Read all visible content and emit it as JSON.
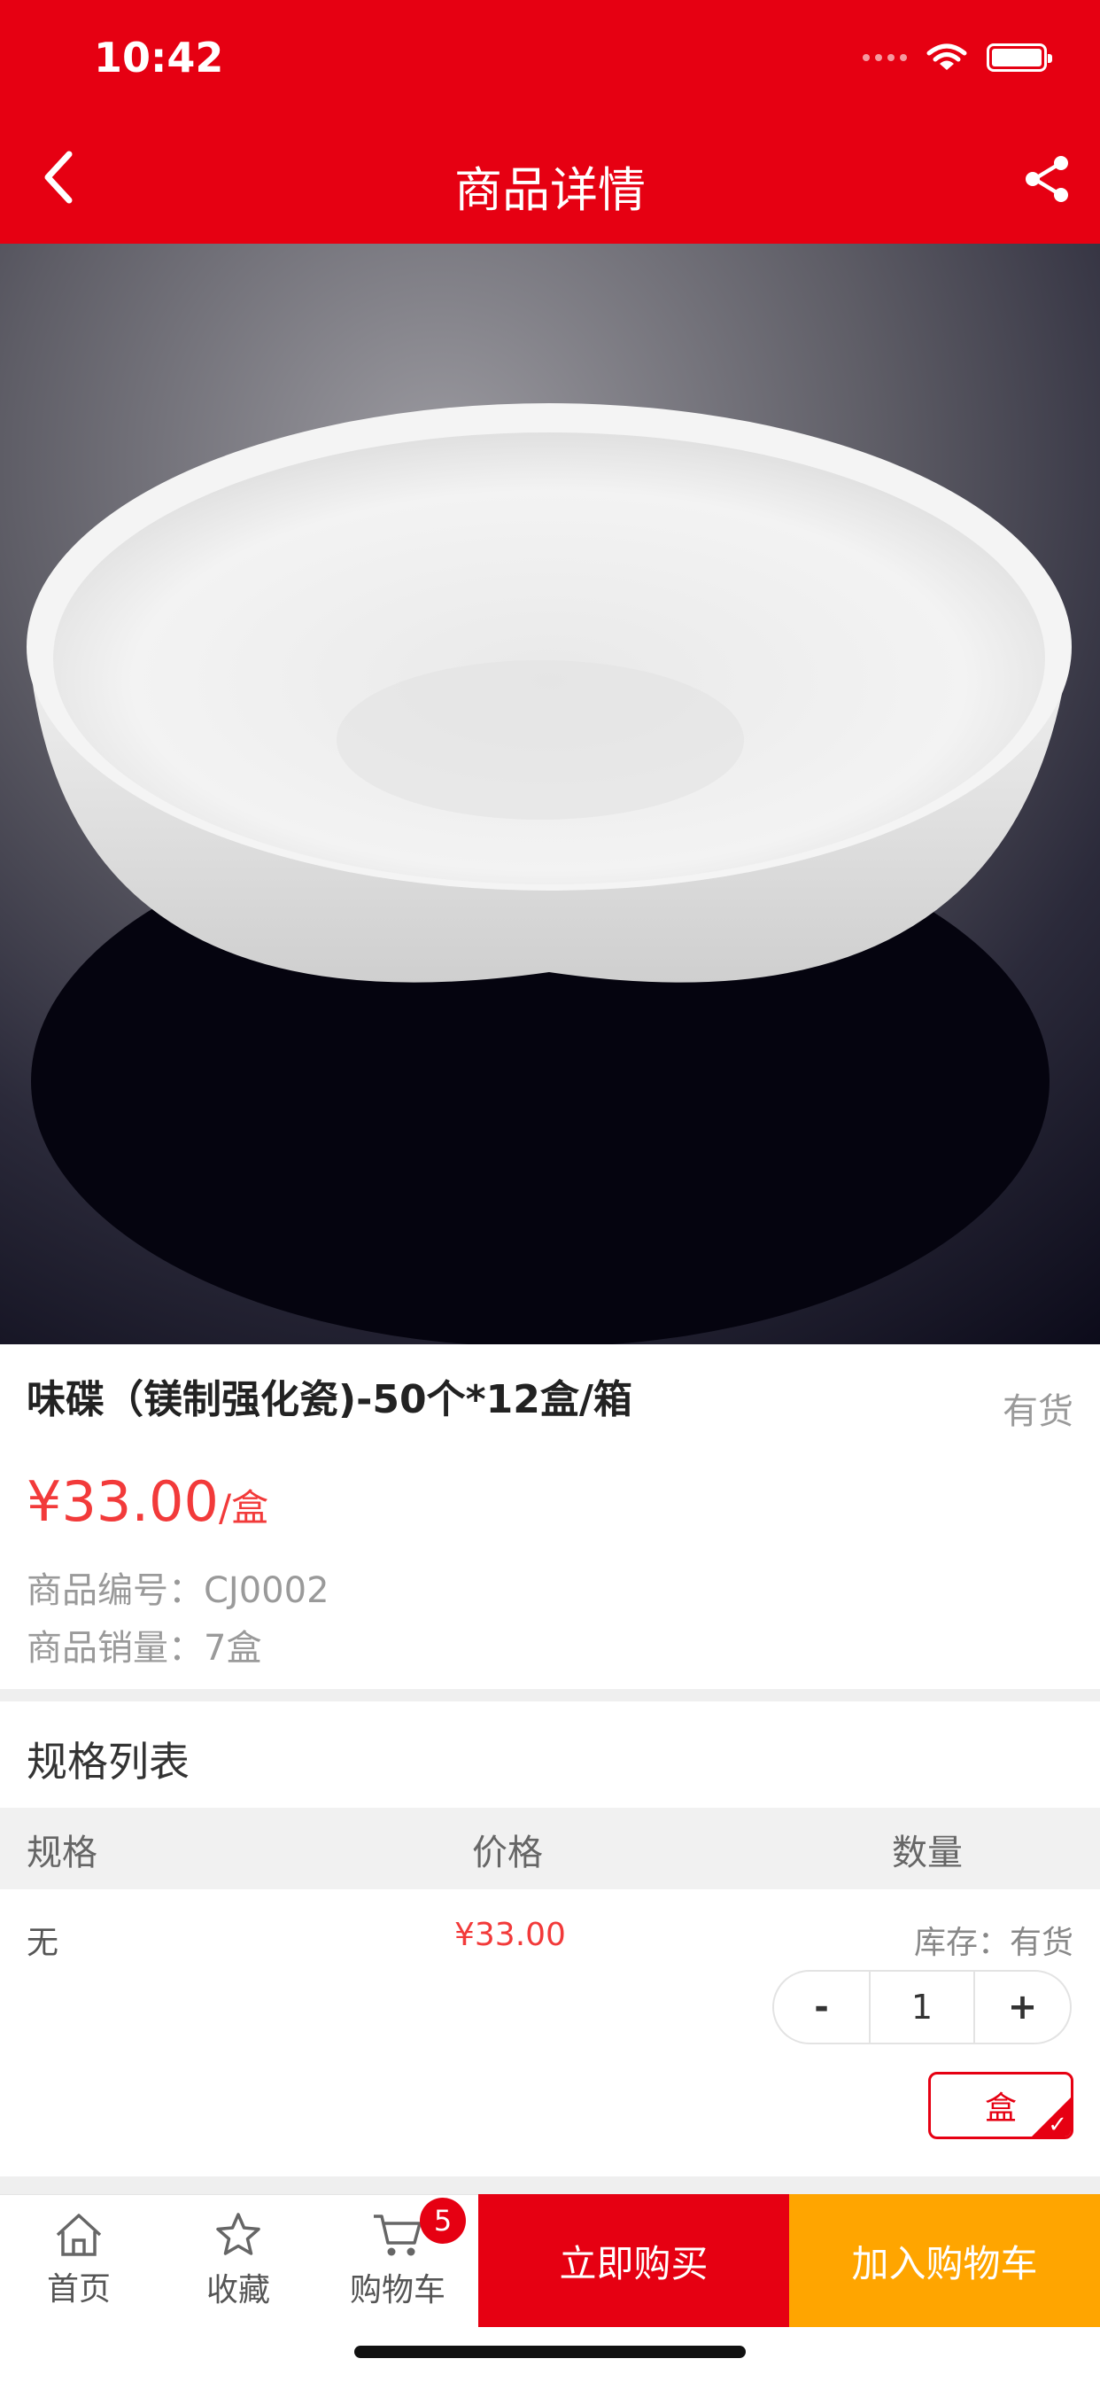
{
  "status_bar": {
    "time": "10:42"
  },
  "header": {
    "title": "商品详情"
  },
  "product": {
    "title": "味碟（镁制强化瓷)-50个*12盒/箱",
    "stock_status": "有货",
    "price": "¥33.00",
    "price_unit": "/盒",
    "code_label": "商品编号：",
    "code_value": "CJ0002",
    "sales_label": "商品销量：",
    "sales_value": "7盒"
  },
  "spec_section": {
    "title": "规格列表",
    "columns": [
      "规格",
      "价格",
      "数量"
    ],
    "rows": [
      {
        "spec": "无",
        "price": "¥33.00",
        "stock": "库存：有货",
        "qty_minus": "-",
        "quantity": "1",
        "qty_plus": "+",
        "unit": "盒"
      }
    ]
  },
  "bottom_bar": {
    "home": "首页",
    "favorite": "收藏",
    "cart": "购物车",
    "cart_count": "5",
    "buy_now": "立即购买",
    "add_to_cart": "加入购物车"
  },
  "colors": {
    "brand_red": "#e60012",
    "price_red": "#f23a3a",
    "cart_orange": "#ffa500"
  },
  "icons": [
    "back-arrow-icon",
    "share-icon",
    "home-icon",
    "star-icon",
    "cart-icon",
    "wifi-icon",
    "battery-icon"
  ]
}
